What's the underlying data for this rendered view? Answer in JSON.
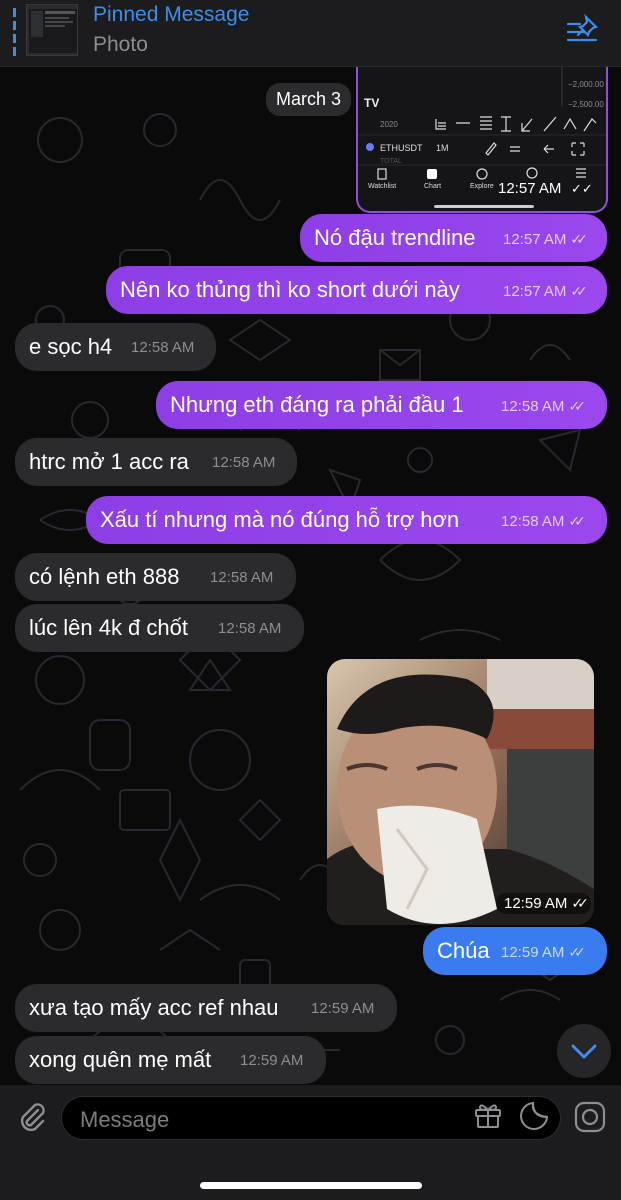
{
  "header": {
    "title": "Pinned Message",
    "subtitle": "Photo",
    "pin_icon": "pin-list-icon"
  },
  "date": "March 3",
  "chart_preview": {
    "price_1": "−2,000.00",
    "price_2": "−2,500.00",
    "year": "2020",
    "symbol": "ETHUSDT",
    "interval": "1M",
    "tabs": [
      "Watchlist",
      "Chart",
      "Explore"
    ],
    "time": "12:57 AM"
  },
  "messages": [
    {
      "dir": "out",
      "text": "Nó đậu trendline",
      "time": "12:57 AM"
    },
    {
      "dir": "out",
      "text": "Nên ko thủng thì ko short dưới này",
      "time": "12:57 AM"
    },
    {
      "dir": "in",
      "text": "e sọc h4",
      "time": "12:58 AM"
    },
    {
      "dir": "out",
      "text": "Nhưng eth đáng ra phải đầu 1",
      "time": "12:58 AM"
    },
    {
      "dir": "in",
      "text": "htrc mở 1 acc ra",
      "time": "12:58 AM"
    },
    {
      "dir": "out",
      "text": "Xấu tí nhưng mà nó đúng hỗ trợ hơn",
      "time": "12:58 AM"
    },
    {
      "dir": "in",
      "text": "có lệnh eth 888",
      "time": "12:58 AM"
    },
    {
      "dir": "in",
      "text": "lúc lên 4k đ chốt",
      "time": "12:58 AM"
    },
    {
      "dir": "out",
      "text": "Chúa",
      "time": "12:59 AM"
    },
    {
      "dir": "in",
      "text": "xưa tạo mấy acc ref nhau",
      "time": "12:59 AM"
    },
    {
      "dir": "in",
      "text": "xong quên mẹ mất",
      "time": "12:59 AM"
    }
  ],
  "video": {
    "time": "12:59 AM"
  },
  "input": {
    "placeholder": "Message"
  },
  "colors": {
    "outgoing": "#9444ea",
    "incoming": "#2b2a2d",
    "accent": "#3d8ee6",
    "blue_bubble": "#3a7cf0"
  }
}
